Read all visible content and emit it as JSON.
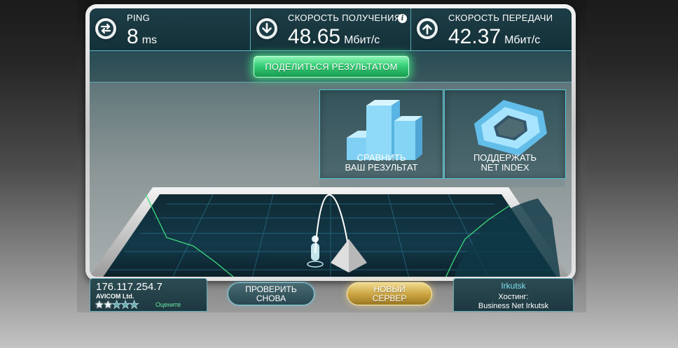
{
  "results": {
    "ping": {
      "label": "PING",
      "value": "8",
      "unit": "ms"
    },
    "download": {
      "label": "СКОРОСТЬ ПОЛУЧЕНИЯ",
      "value": "48.65",
      "unit": "Мбит/с"
    },
    "upload": {
      "label": "СКОРОСТЬ ПЕРЕДАЧИ",
      "value": "42.37",
      "unit": "Мбит/с"
    }
  },
  "share_label": "ПОДЕЛИТЬСЯ РЕЗУЛЬТАТОМ",
  "tiles": {
    "compare": {
      "line1": "СРАВНИТЬ",
      "line2": "ВАШ РЕЗУЛЬТАТ"
    },
    "support": {
      "line1": "ПОДДЕРЖАТЬ",
      "line2": "NET INDEX"
    }
  },
  "client": {
    "ip": "176.117.254.7",
    "isp": "AVICOM Ltd.",
    "rating_stars": 2,
    "rating_max": 5,
    "rate_label": "Оцените"
  },
  "buttons": {
    "retest": {
      "line1": "ПРОВЕРИТЬ",
      "line2": "СНОВА"
    },
    "new_server": {
      "line1": "НОВЫЙ",
      "line2": "СЕРВЕР"
    }
  },
  "server": {
    "city": "Irkutsk",
    "hosting_label": "Хостинг:",
    "host_name": "Business Net Irkutsk"
  },
  "icons": {
    "ping": "swap-arrows-icon",
    "download": "arrow-down-icon",
    "upload": "arrow-up-icon",
    "info": "info-icon",
    "compare": "bar-chart-icon",
    "support": "net-index-logo-icon"
  },
  "colors": {
    "accent_green": "#36cf76",
    "accent_gold": "#caa23f",
    "panel_dark": "#1d3d46",
    "glow_cyan": "#56c6d4"
  }
}
